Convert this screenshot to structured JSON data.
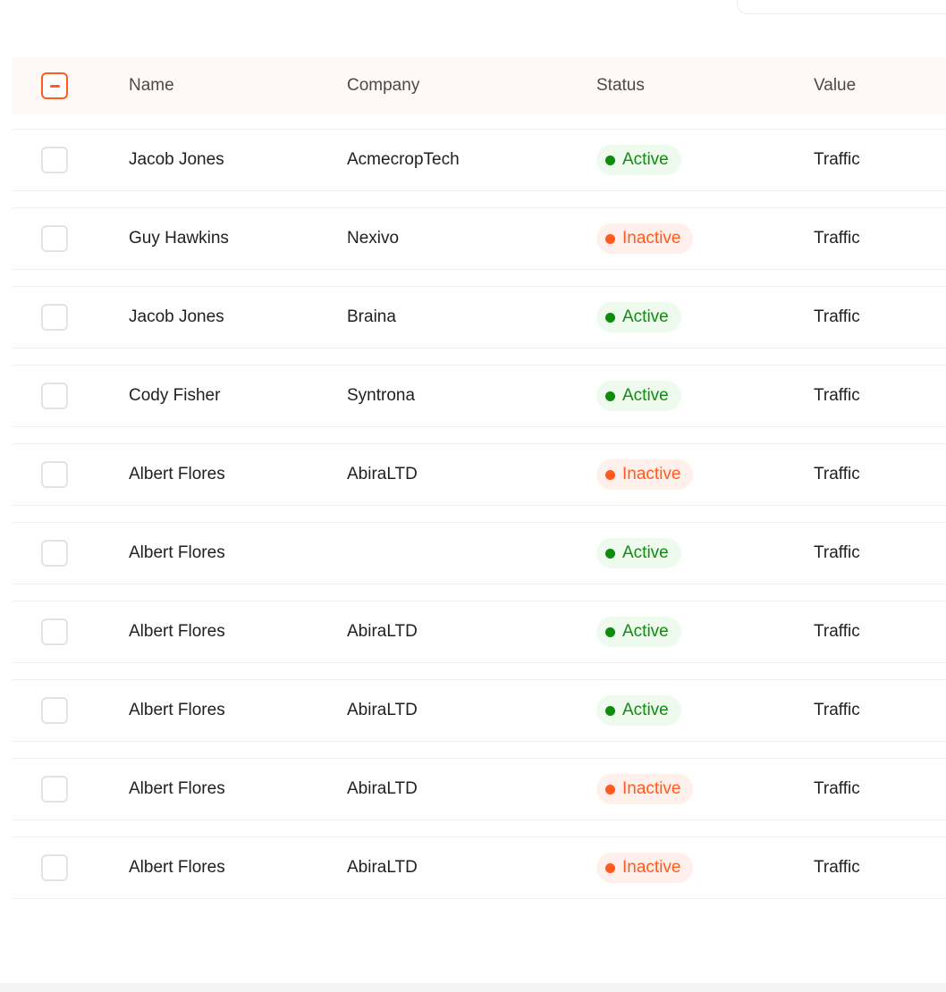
{
  "table": {
    "headers": {
      "name": "Name",
      "company": "Company",
      "status": "Status",
      "value": "Value"
    },
    "select_all_state": "indeterminate",
    "rows": [
      {
        "name": "Jacob Jones",
        "company": "AcmecropTech",
        "status": "Active",
        "value": "Traffic"
      },
      {
        "name": "Guy Hawkins",
        "company": "Nexivo",
        "status": "Inactive",
        "value": "Traffic"
      },
      {
        "name": "Jacob Jones",
        "company": "Braina",
        "status": "Active",
        "value": "Traffic"
      },
      {
        "name": "Cody Fisher",
        "company": "Syntrona",
        "status": "Active",
        "value": "Traffic"
      },
      {
        "name": "Albert Flores",
        "company": "AbiraLTD",
        "status": "Inactive",
        "value": "Traffic"
      },
      {
        "name": "Albert Flores",
        "company": "",
        "status": "Active",
        "value": "Traffic"
      },
      {
        "name": "Albert Flores",
        "company": "AbiraLTD",
        "status": "Active",
        "value": "Traffic"
      },
      {
        "name": "Albert Flores",
        "company": "AbiraLTD",
        "status": "Active",
        "value": "Traffic"
      },
      {
        "name": "Albert Flores",
        "company": "AbiraLTD",
        "status": "Inactive",
        "value": "Traffic"
      },
      {
        "name": "Albert Flores",
        "company": "AbiraLTD",
        "status": "Inactive",
        "value": "Traffic"
      }
    ]
  },
  "colors": {
    "accent": "#ff5a1f",
    "active_text": "#128a12",
    "active_bg": "#eefaee",
    "inactive_text": "#ff5a1f",
    "inactive_bg": "#fff0ec",
    "header_bg": "#fff8f8"
  }
}
